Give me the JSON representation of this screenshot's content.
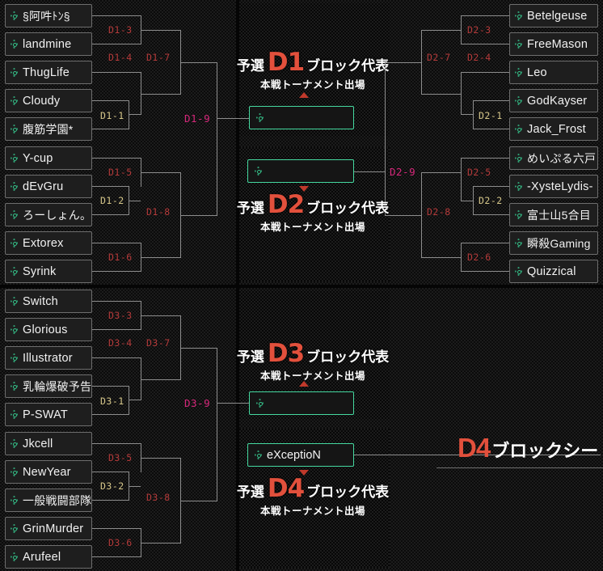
{
  "blocks": {
    "d1": {
      "prefix": "予選",
      "code": "D1",
      "suffix": "ブロック代表",
      "note": "本戦トーナメント出場",
      "winner": ""
    },
    "d2": {
      "prefix": "予選",
      "code": "D2",
      "suffix": "ブロック代表",
      "note": "本戦トーナメント出場",
      "winner": ""
    },
    "d3": {
      "prefix": "予選",
      "code": "D3",
      "suffix": "ブロック代表",
      "note": "本戦トーナメント出場",
      "winner": ""
    },
    "d4": {
      "prefix": "予選",
      "code": "D4",
      "suffix": "ブロック代表",
      "note": "本戦トーナメント出場",
      "winner": "eXceptioN"
    }
  },
  "seed": {
    "code": "D4",
    "label": "ブロックシード"
  },
  "teams_d1": [
    {
      "name": "§阿吽ﾄﾝ§"
    },
    {
      "name": "landmine"
    },
    {
      "name": "ThugLife"
    },
    {
      "name": "Cloudy"
    },
    {
      "name": "腹筋学園*"
    },
    {
      "name": "Y-cup"
    },
    {
      "name": "dEvGru"
    },
    {
      "name": "ろーしょん。"
    },
    {
      "name": "Extorex"
    },
    {
      "name": "Syrink"
    }
  ],
  "teams_d3": [
    {
      "name": "Switch"
    },
    {
      "name": "Glorious"
    },
    {
      "name": "Illustrator"
    },
    {
      "name": "乳輪爆破予告"
    },
    {
      "name": "P-SWAT"
    },
    {
      "name": "Jkcell"
    },
    {
      "name": "NewYear"
    },
    {
      "name": "一般戦闘部隊"
    },
    {
      "name": "GrinMurder"
    },
    {
      "name": "Arufeel"
    }
  ],
  "teams_d2": [
    {
      "name": "Betelgeuse"
    },
    {
      "name": "FreeMason"
    },
    {
      "name": "Leo"
    },
    {
      "name": "GodKayser"
    },
    {
      "name": "Jack_Frost"
    },
    {
      "name": "めいぷる六戸"
    },
    {
      "name": "-XysteLydis-"
    },
    {
      "name": "富士山5合目"
    },
    {
      "name": "瞬殺Gaming"
    },
    {
      "name": "Quizzical"
    }
  ],
  "matches_d1": [
    {
      "id": "D1-3"
    },
    {
      "id": "D1-1"
    },
    {
      "id": "D1-4"
    },
    {
      "id": "D1-7"
    },
    {
      "id": "D1-5"
    },
    {
      "id": "D1-2"
    },
    {
      "id": "D1-6"
    },
    {
      "id": "D1-8"
    },
    {
      "id": "D1-9"
    }
  ],
  "matches_d2": [
    {
      "id": "D2-3"
    },
    {
      "id": "D2-4"
    },
    {
      "id": "D2-1"
    },
    {
      "id": "D2-7"
    },
    {
      "id": "D2-5"
    },
    {
      "id": "D2-2"
    },
    {
      "id": "D2-6"
    },
    {
      "id": "D2-8"
    },
    {
      "id": "D2-9"
    }
  ],
  "matches_d3": [
    {
      "id": "D3-3"
    },
    {
      "id": "D3-1"
    },
    {
      "id": "D3-4"
    },
    {
      "id": "D3-7"
    },
    {
      "id": "D3-5"
    },
    {
      "id": "D3-2"
    },
    {
      "id": "D3-6"
    },
    {
      "id": "D3-8"
    },
    {
      "id": "D3-9"
    }
  ],
  "colors": {
    "accent_red": "#e2503c",
    "match_red": "#b43a3a",
    "match_gold": "#d6c78a",
    "match_magenta": "#d6277a",
    "slot_green": "#45d9a0",
    "line": "#8d8d8d"
  }
}
